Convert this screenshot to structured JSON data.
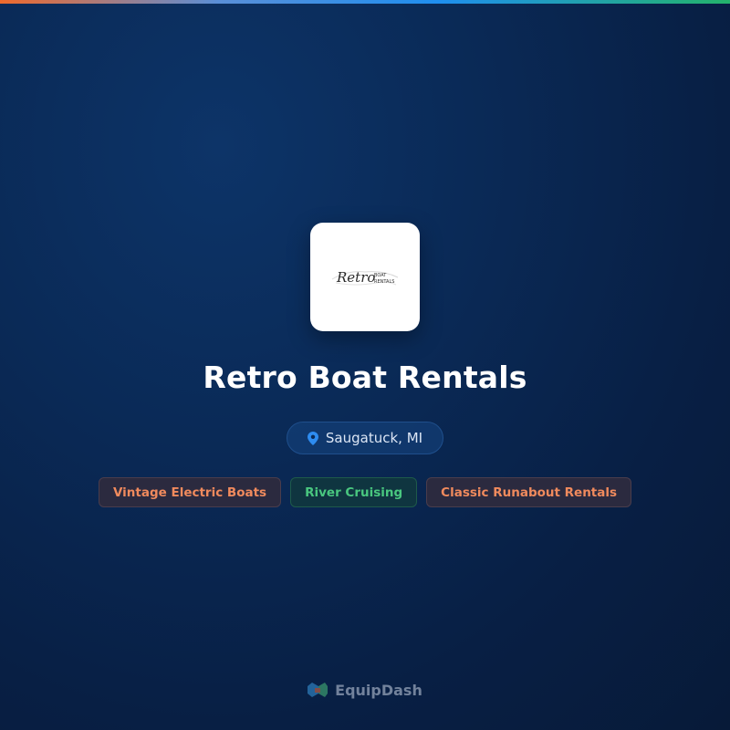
{
  "business": {
    "logo_text": "Retro",
    "logo_subtext_1": "BOAT",
    "logo_subtext_2": "RENTALS",
    "name": "Retro Boat Rentals",
    "location": "Saugatuck, MI"
  },
  "tags": [
    {
      "label": "Vintage Electric Boats",
      "color": "#f08a5d"
    },
    {
      "label": "River Cruising",
      "color": "#49c77f"
    },
    {
      "label": "Classic Runabout Rentals",
      "color": "#f08a5d"
    }
  ],
  "footer": {
    "brand_name": "EquipDash",
    "brand_icon": "equipdash-logo-icon"
  },
  "icons": {
    "location": "map-pin-icon"
  },
  "colors": {
    "accent_orange": "#f08a5d",
    "accent_green": "#49c77f",
    "pin_blue": "#2e8cf0"
  }
}
